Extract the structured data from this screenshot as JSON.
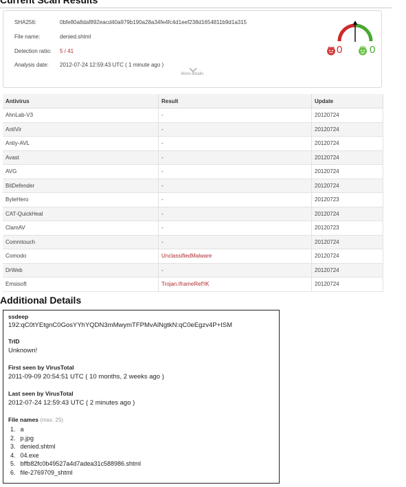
{
  "scan": {
    "title": "Current Scan Results",
    "sha256_label": "SHA256:",
    "sha256": "0bfe80a8daf892eacd40a979b190a28a34fe4fc4d1eef238d1654811b9d1a315",
    "filename_label": "File name:",
    "filename": "denied.shtml",
    "ratio_label": "Detection ratio:",
    "ratio": "5 / 41",
    "date_label": "Analysis date:",
    "date": "2012-07-24 12:59:43 UTC ( 1 minute ago )",
    "more_details": "More details",
    "votes_bad": "0",
    "votes_good": "0",
    "colors": {
      "malicious": "#b02b2c",
      "good": "#5cb832",
      "bad_face": "#d9534f"
    }
  },
  "table": {
    "headers": [
      "Antivirus",
      "Result",
      "Update"
    ],
    "rows": [
      {
        "av": "AhnLab-V3",
        "result": "-",
        "update": "20120724"
      },
      {
        "av": "AntiVir",
        "result": "-",
        "update": "20120724"
      },
      {
        "av": "Antiy-AVL",
        "result": "-",
        "update": "20120724"
      },
      {
        "av": "Avast",
        "result": "-",
        "update": "20120724"
      },
      {
        "av": "AVG",
        "result": "-",
        "update": "20120724"
      },
      {
        "av": "BitDefender",
        "result": "-",
        "update": "20120724"
      },
      {
        "av": "ByteHero",
        "result": "-",
        "update": "20120723"
      },
      {
        "av": "CAT-QuickHeal",
        "result": "-",
        "update": "20120724"
      },
      {
        "av": "ClamAV",
        "result": "-",
        "update": "20120723"
      },
      {
        "av": "Commtouch",
        "result": "-",
        "update": "20120724"
      },
      {
        "av": "Comodo",
        "result": "UnclassifiedMalware",
        "update": "20120724"
      },
      {
        "av": "DrWeb",
        "result": "-",
        "update": "20120724"
      },
      {
        "av": "Emsisoft",
        "result": "Trojan.IframeRef!IK",
        "update": "20120724"
      }
    ]
  },
  "details": {
    "title": "Additional Details",
    "ssdeep_label": "ssdeep",
    "ssdeep": "192:qC0tYEtgnC0GosYYhYQDN3mMwymTFPMvAlNgtkN:qC0eEgzv4P+ISM",
    "trid_label": "TrID",
    "trid": "Unknown!",
    "first_seen_label": "First seen by VirusTotal",
    "first_seen": "2011-09-09 20:54:51 UTC ( 10 months, 2 weeks ago )",
    "last_seen_label": "Last seen by VirusTotal",
    "last_seen": "2012-07-24 12:59:43 UTC ( 2 minutes ago )",
    "file_names_label": "File names",
    "file_names_max": "(max. 25)",
    "file_names": [
      {
        "n": "1.",
        "name": "a"
      },
      {
        "n": "2.",
        "name": "p.jpg"
      },
      {
        "n": "3.",
        "name": "denied.shtml"
      },
      {
        "n": "4.",
        "name": "04.exe"
      },
      {
        "n": "5.",
        "name": "bffb82fc0b49527a4d7adea31c588986.shtml"
      },
      {
        "n": "6.",
        "name": "file-2769709_shtml"
      }
    ]
  }
}
